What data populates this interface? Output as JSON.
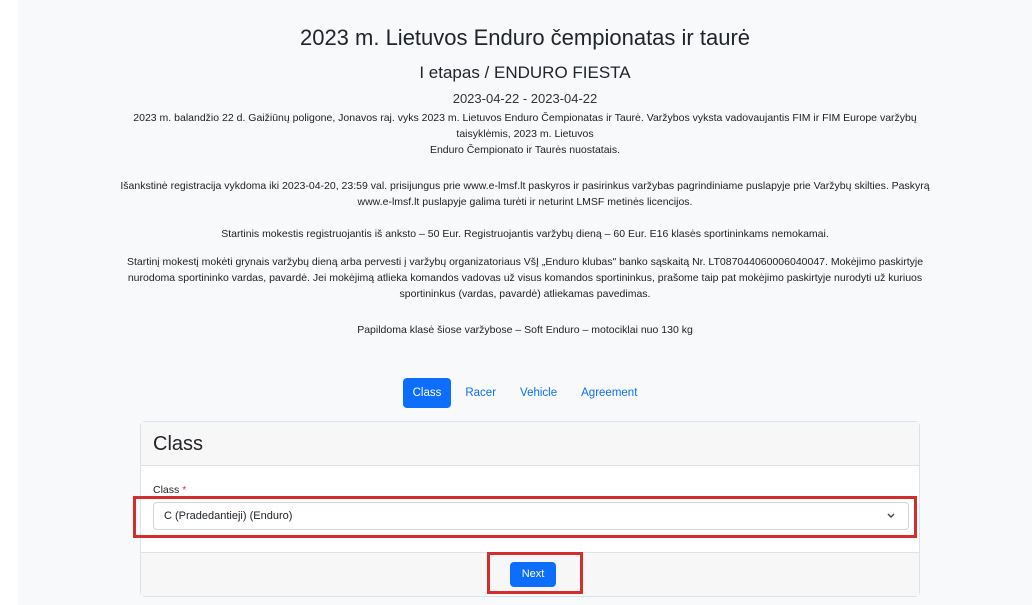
{
  "header": {
    "title": "2023 m. Lietuvos Enduro čempionatas ir taurė",
    "subtitle": "I etapas / ENDURO FIESTA",
    "dates": "2023-04-22 - 2023-04-22"
  },
  "info": {
    "p1_line1": "2023 m. balandžio 22 d. Gaižiūnų poligone, Jonavos raj. vyks 2023 m. Lietuvos Enduro Čempionatas ir Taurė. Varžybos vyksta vadovaujantis FIM ir FIM Europe varžybų",
    "p1_line2": "taisyklėmis, 2023 m. Lietuvos",
    "p1_line3": "Enduro Čempionato ir Taurės nuostatais.",
    "p2_line1": "Išankstinė registracija vykdoma iki 2023-04-20, 23:59 val. prisijungus prie www.e-lmsf.lt paskyros ir pasirinkus varžybas pagrindiniame puslapyje prie Varžybų skilties. Paskyrą",
    "p2_line2": "www.e-lmsf.lt puslapyje galima turėti ir neturint LMSF metinės licencijos.",
    "p3": "Startinis mokestis registruojantis iš anksto – 50 Eur. Registruojantis varžybų dieną – 60 Eur. E16 klasės sportininkams nemokamai.",
    "p4_line1": "Startinį mokestį mokėti grynais varžybų dieną arba pervesti į varžybų organizatoriaus VšĮ „Enduro klubas\" banko sąskaitą Nr. LT087044060006040047. Mokėjimo paskirtyje",
    "p4_line2": "nurodoma sportininko vardas, pavardė. Jei mokėjimą atlieka komandos vadovas už visus komandos sportininkus, prašome taip pat mokėjimo paskirtyje nurodyti už kuriuos",
    "p4_line3": "sportininkus (vardas, pavardė) atliekamas pavedimas.",
    "p5": "Papildoma klasė šiose varžybose – Soft Enduro – motociklai nuo 130 kg"
  },
  "tabs": [
    {
      "label": "Class",
      "active": true
    },
    {
      "label": "Racer",
      "active": false
    },
    {
      "label": "Vehicle",
      "active": false
    },
    {
      "label": "Agreement",
      "active": false
    }
  ],
  "card": {
    "heading": "Class",
    "field_label": "Class",
    "required_mark": "*",
    "selected_value": "C (Pradedantieji) (Enduro)",
    "next_label": "Next"
  },
  "colors": {
    "primary": "#0d6efd",
    "highlight": "#d42d2d",
    "required": "#dc3545"
  }
}
